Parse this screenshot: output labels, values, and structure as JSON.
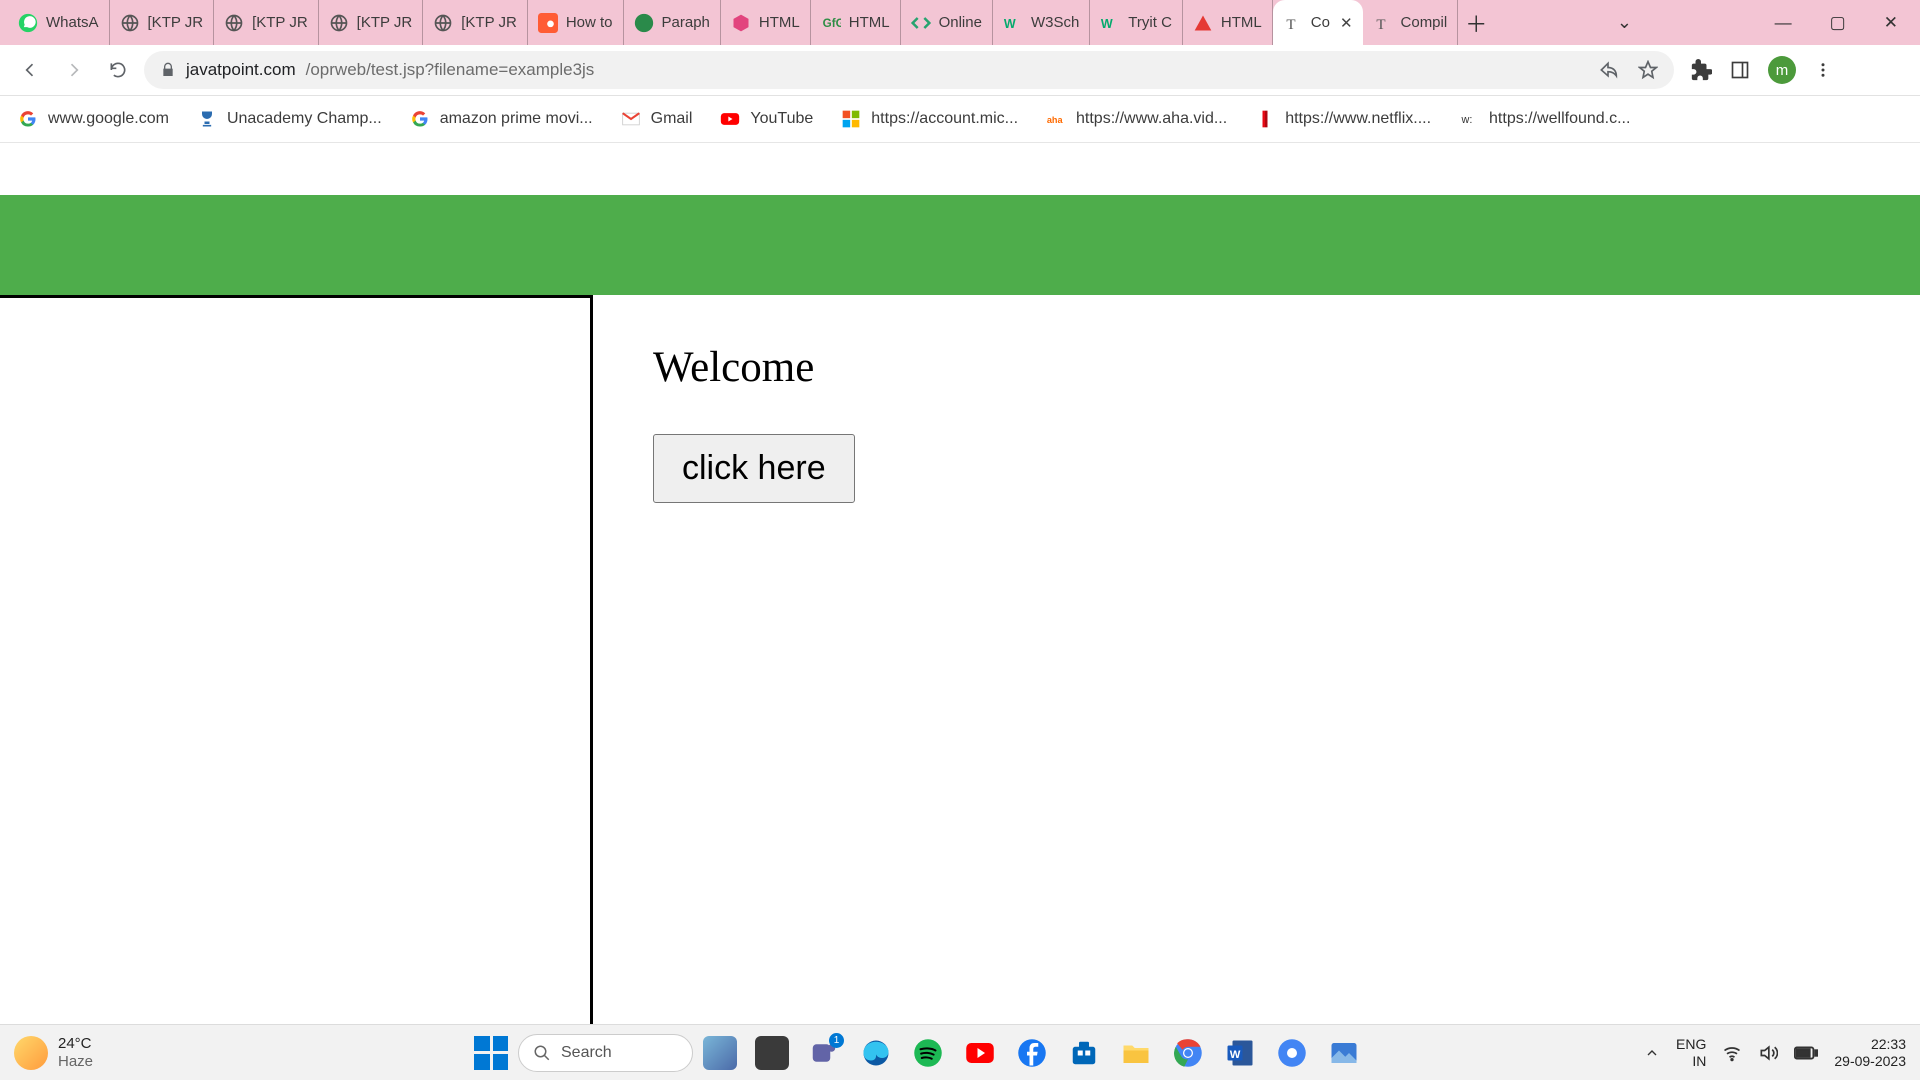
{
  "tabs": [
    {
      "label": "WhatsA",
      "icon": "whatsapp"
    },
    {
      "label": "[KTP JR",
      "icon": "globe"
    },
    {
      "label": "[KTP JR",
      "icon": "globe"
    },
    {
      "label": "[KTP JR",
      "icon": "globe"
    },
    {
      "label": "[KTP JR",
      "icon": "globe"
    },
    {
      "label": "How to",
      "icon": "hubspot"
    },
    {
      "label": "Paraph",
      "icon": "quillbot"
    },
    {
      "label": "HTML ",
      "icon": "cube"
    },
    {
      "label": "HTML ",
      "icon": "gfg"
    },
    {
      "label": "Online",
      "icon": "code"
    },
    {
      "label": "W3Sch",
      "icon": "w3"
    },
    {
      "label": "Tryit C",
      "icon": "w3"
    },
    {
      "label": "HTML ",
      "icon": "triangle"
    },
    {
      "label": "Co",
      "icon": "jt",
      "active": true
    },
    {
      "label": "Compil",
      "icon": "jt"
    }
  ],
  "url": {
    "domain": "javatpoint.com",
    "rest": "/oprweb/test.jsp?filename=example3js"
  },
  "avatar_initial": "m",
  "bookmarks": [
    {
      "label": "www.google.com",
      "icon": "google"
    },
    {
      "label": "Unacademy Champ...",
      "icon": "trophy"
    },
    {
      "label": "amazon prime movi...",
      "icon": "google"
    },
    {
      "label": "Gmail",
      "icon": "gmail"
    },
    {
      "label": "YouTube",
      "icon": "youtube"
    },
    {
      "label": "https://account.mic...",
      "icon": "microsoft"
    },
    {
      "label": "https://www.aha.vid...",
      "icon": "aha"
    },
    {
      "label": "https://www.netflix....",
      "icon": "netflix"
    },
    {
      "label": "https://wellfound.c...",
      "icon": "wtext"
    }
  ],
  "page": {
    "heading": "Welcome",
    "button_label": "click here"
  },
  "taskbar": {
    "weather_temp": "24°C",
    "weather_desc": "Haze",
    "search_placeholder": "Search",
    "lang_top": "ENG",
    "lang_bot": "IN",
    "time": "22:33",
    "date": "29-09-2023"
  }
}
